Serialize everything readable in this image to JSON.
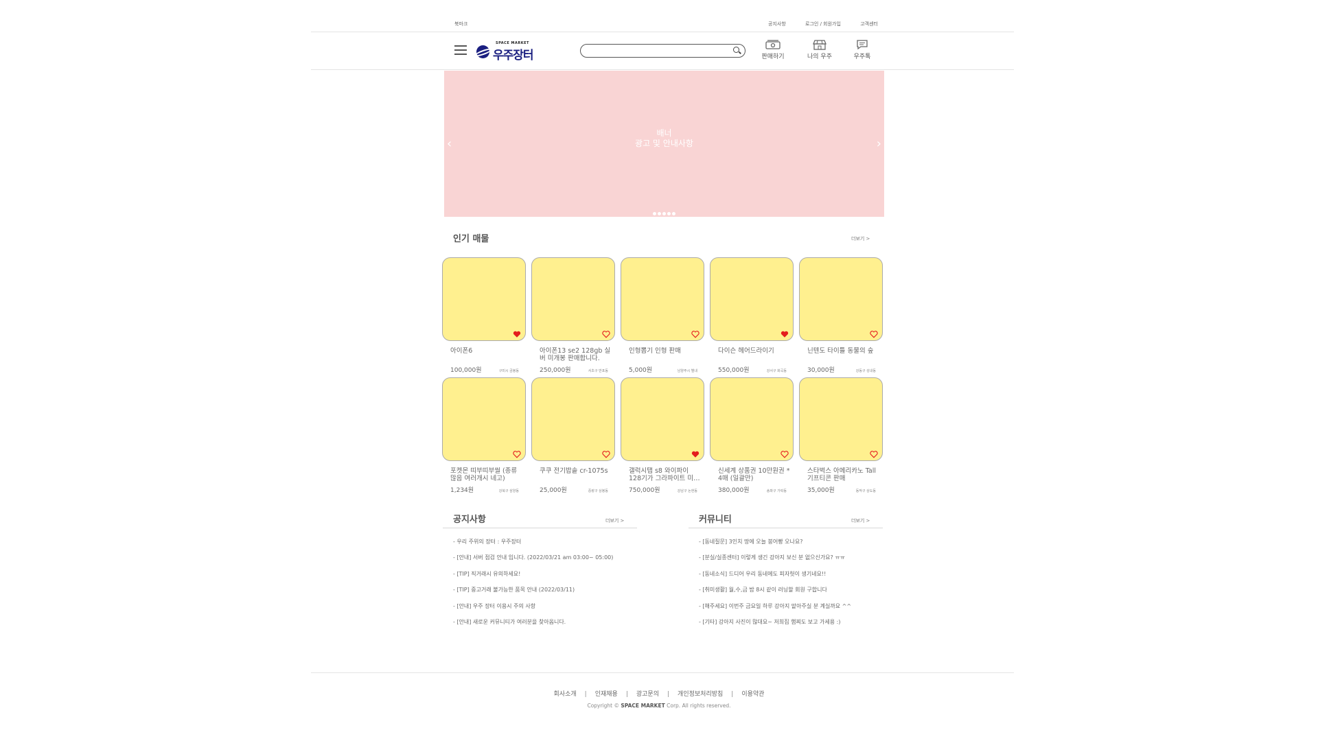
{
  "top_util": {
    "bookmark": "북마크",
    "notice": "공지사항",
    "login": "로그인 / 회원가입",
    "support": "고객센터"
  },
  "header": {
    "logo_sub": "SPACE MARKET",
    "logo_name": "우주장터",
    "search_placeholder": "",
    "nav": [
      {
        "label": "판매하기",
        "icon": "sell-icon"
      },
      {
        "label": "나의 우주",
        "icon": "store-icon"
      },
      {
        "label": "우주톡",
        "icon": "chat-icon"
      }
    ]
  },
  "banner": {
    "line1": "배너",
    "line2": "광고 및 안내사항",
    "prev": "‹",
    "next": "›",
    "dot_count": 5
  },
  "popular": {
    "title": "인기 매물",
    "more": "더보기 >",
    "items": [
      {
        "title": "아이폰6",
        "price": "100,000원",
        "loc": "구미시 금봉동",
        "liked": true
      },
      {
        "title": "아이폰13 se2 128gb 실버 미개봉 판매합니다.",
        "price": "250,000원",
        "loc": "서초구 반포동",
        "liked": false
      },
      {
        "title": "인형뽑기 인형 판매",
        "price": "5,000원",
        "loc": "남양주시 별내",
        "liked": false
      },
      {
        "title": "다이슨 헤어드라이기",
        "price": "550,000원",
        "loc": "강서구 화곡동",
        "liked": true
      },
      {
        "title": "닌텐도 타이틀 동물의 숲",
        "price": "30,000원",
        "loc": "강동구 성내동",
        "liked": false
      },
      {
        "title": "포켓몬 띠부띠부씰 (종류 많음 여러개시 네고)",
        "price": "1,234원",
        "loc": "강북구 삼양동",
        "liked": false
      },
      {
        "title": "쿠쿠 전기밥솥 cr-1075s",
        "price": "25,000원",
        "loc": "중랑구 상봉동",
        "liked": false
      },
      {
        "title": "갤럭시탭 s8 와이파이 128기가 그라파이트 미…",
        "price": "750,000원",
        "loc": "강남구 논현동",
        "liked": true
      },
      {
        "title": "신세계 상품권 10만원권 * 4매 (일괄만)",
        "price": "380,000원",
        "loc": "송파구 가락동",
        "liked": false
      },
      {
        "title": "스타벅스 아메리카노 Tall 기프티콘 판매",
        "price": "35,000원",
        "loc": "동작구 상도동",
        "liked": false
      }
    ]
  },
  "notice": {
    "title": "공지사항",
    "more": "더보기 >",
    "items": [
      "- 우리 주위의 장터 : 우주장터",
      "- [안내] 서버 점검 안내 입니다. (2022/03/21 am 03:00~ 05:00)",
      "- [TIP] 직거래시 유의하세요!",
      "- [TIP] 중고거래 불가능한 품목 안내 (2022/03/11)",
      "- [안내] 우주 장터 이용시 주의 사항",
      "- [안내] 새로운 커뮤니티가 여러분을 찾아옵니다."
    ]
  },
  "community": {
    "title": "커뮤니티",
    "more": "더보기 >",
    "items": [
      "- [동네질문] 3인치 땅에 오늘 붕어빵 오나요?",
      "- [분실/실종센터] 이렇게 생긴 강아지 보신 분 없으신가요? ㅠㅠ",
      "- [동네소식] 드디어 우리 동네에도 피자헛이 생기네요!!",
      "- [취미생활] 월,수,금 밤 8시 같이 러닝할 회원 구합니다",
      "- [해주세요] 이번주 금요일 하루 강아지 맡아주실 분 계실까요 ^^",
      "- [기타] 강아지 사진이 많대요~ 저희집 햄찌도 보고 가세용 :)"
    ]
  },
  "footer": {
    "links": [
      "회사소개",
      "인재채용",
      "광고문의",
      "개인정보처리방침",
      "이용약관"
    ],
    "copyright_pre": "Copyright ©",
    "copyright_brand": "SPACE MARKET",
    "copyright_post": "Corp. All rights reserved."
  },
  "colors": {
    "banner": "#f9d4d4",
    "card": "#fff08f",
    "heart": "#e41d1d",
    "logo": "#1a1f80"
  }
}
